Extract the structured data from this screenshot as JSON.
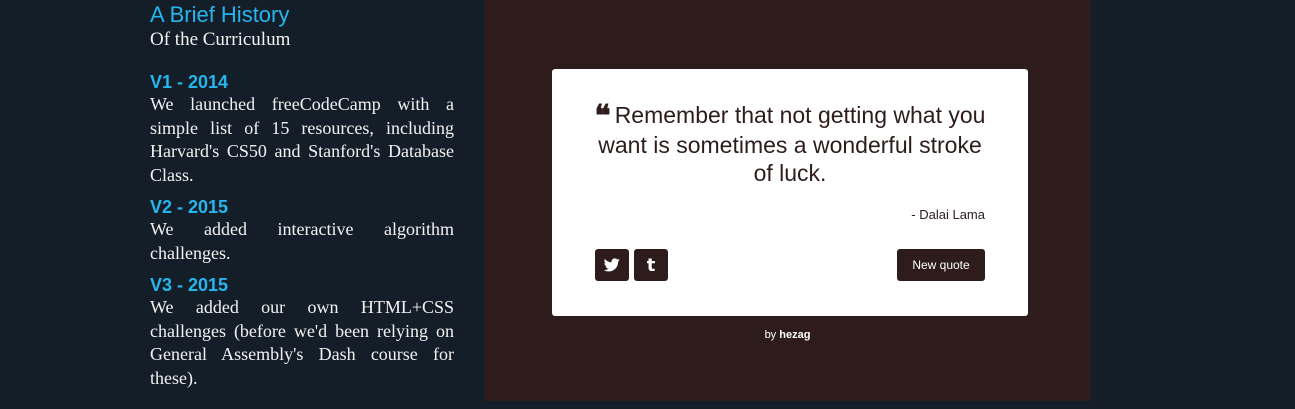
{
  "history": {
    "title": "A Brief History",
    "subtitle": "Of the Curriculum",
    "sections": [
      {
        "heading": "V1 - 2014",
        "text": "We launched freeCodeCamp with a simple list of 15 resources, including Harvard's CS50 and Stanford's Database Class."
      },
      {
        "heading": "V2 - 2015",
        "text": "We added interactive algorithm challenges."
      },
      {
        "heading": "V3 - 2015",
        "text": "We added our own HTML+CSS challenges (before we'd been relying on General Assembly's Dash course for these)."
      }
    ]
  },
  "quote": {
    "text": "Remember that not getting what you want is sometimes a wonderful stroke of luck.",
    "author": "- Dalai Lama",
    "quote_icon": "quote-left-icon",
    "tweet_icon": "twitter-icon",
    "tumblr_icon": "tumblr-icon",
    "new_quote_label": "New quote"
  },
  "credit": {
    "prefix": "by",
    "author": "hezag"
  },
  "colors": {
    "page_background": "#131e28",
    "accent_blue": "#27b5ee",
    "panel_background": "#2e1c1c",
    "card_background": "#ffffff"
  }
}
